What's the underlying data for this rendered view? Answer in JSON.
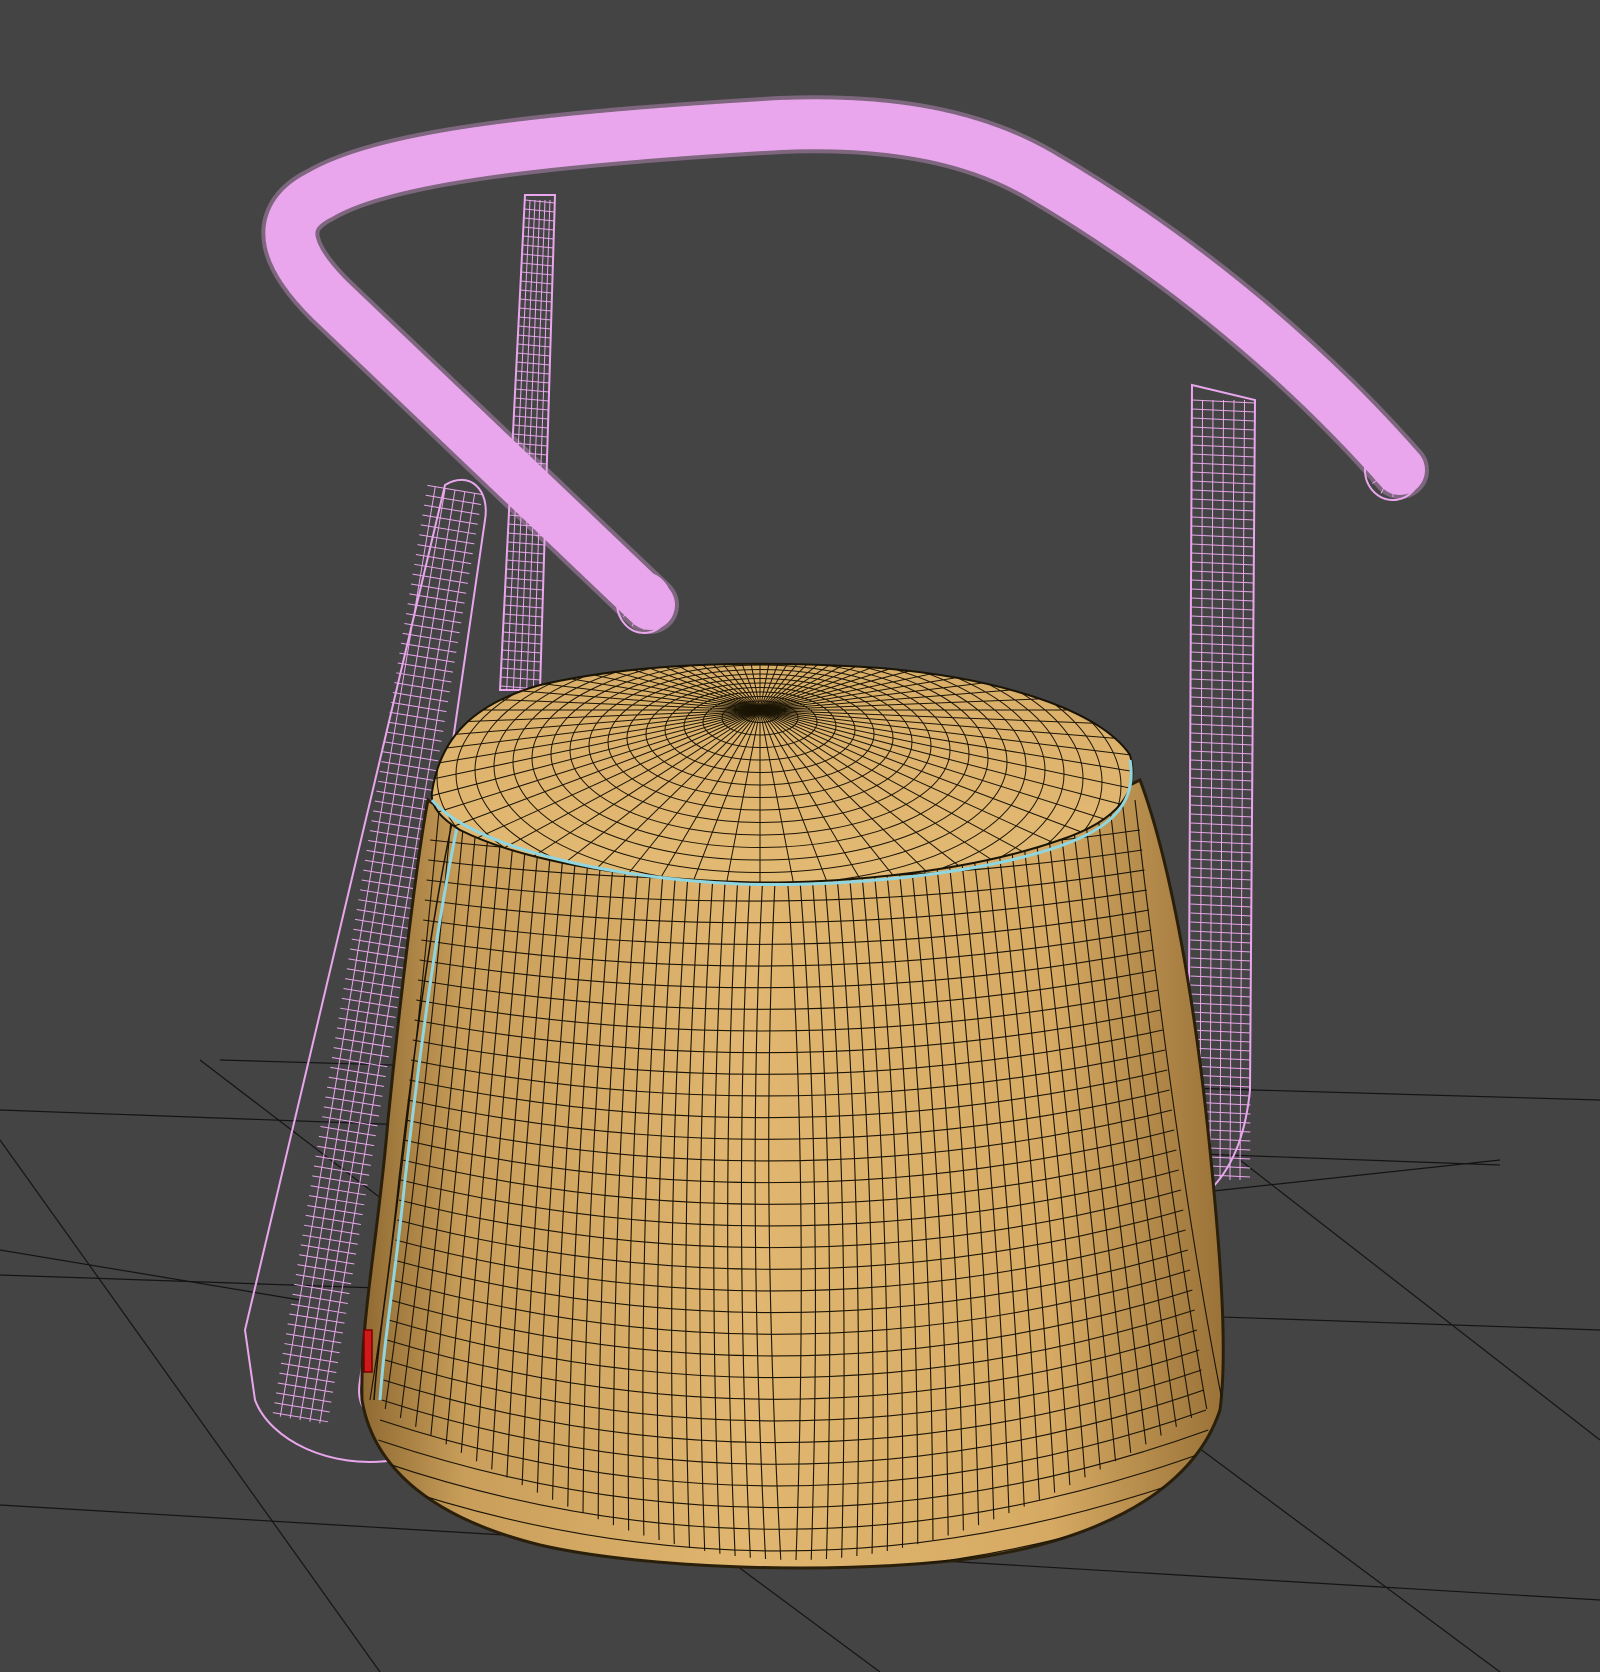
{
  "viewport": {
    "background_color": "#444444",
    "grid_color": "#141414"
  },
  "scene": {
    "objects": [
      {
        "name": "chair-frame-tube",
        "display": "wireframe",
        "wire_color": "#e9a6ec"
      },
      {
        "name": "pouf-seat",
        "display": "shaded-with-edged-faces",
        "surface_color": "#d8ad66",
        "edge_color": "#1a1405",
        "seam_color": "#8fd6e0"
      }
    ],
    "accent_marker_color": "#d01a1a"
  }
}
